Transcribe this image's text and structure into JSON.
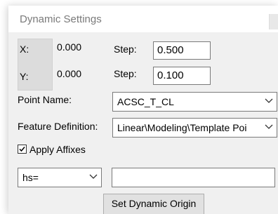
{
  "window": {
    "title": "Dynamic Settings"
  },
  "coords": {
    "x_label": "X:",
    "x_value": "0.000",
    "y_label": "Y:",
    "y_value": "0.000"
  },
  "steps": {
    "label1": "Step:",
    "value1": "0.500",
    "label2": "Step:",
    "value2": "0.100"
  },
  "point_name": {
    "label": "Point Name:",
    "value": "ACSC_T_CL"
  },
  "feature_definition": {
    "label": "Feature Definition:",
    "value": "Linear\\Modeling\\Template Poi"
  },
  "apply_affixes": {
    "label": "Apply Affixes",
    "checked": true
  },
  "affix": {
    "type_value": "hs=",
    "text_value": ""
  },
  "actions": {
    "set_origin_label": "Set Dynamic Origin"
  }
}
